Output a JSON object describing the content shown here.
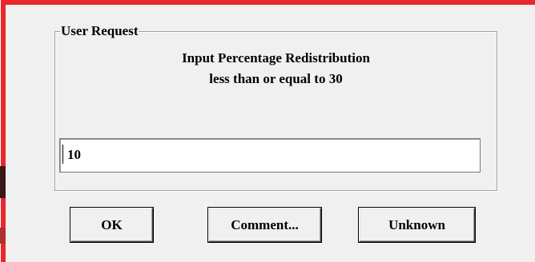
{
  "dialog": {
    "group_title": "User Request",
    "prompt_line_1": "Input Percentage Redistribution",
    "prompt_line_2": "less than or equal to 30",
    "input": {
      "value": "10",
      "placeholder": ""
    },
    "buttons": {
      "ok_label": "OK",
      "comment_label": "Comment...",
      "unknown_label": "Unknown"
    }
  },
  "colors": {
    "frame_accent": "#e8282a",
    "dialog_background": "#f0f0f0",
    "input_background": "#ffffff"
  }
}
